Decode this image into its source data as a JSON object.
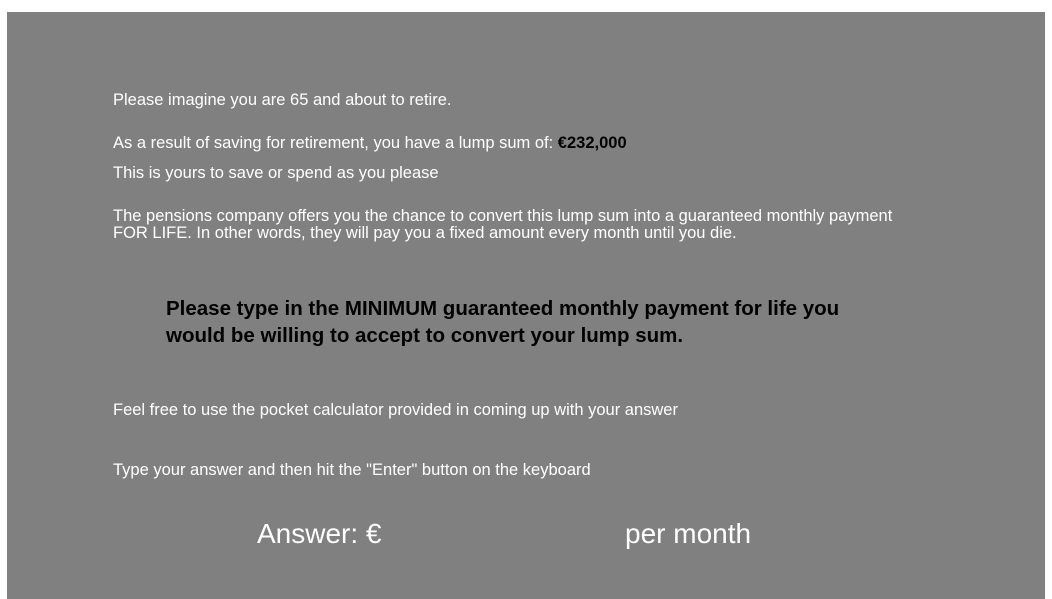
{
  "intro": "Please imagine you are 65 and about to retire.",
  "lump_sum_text": "As a result of saving for retirement, you have a lump sum of:",
  "lump_sum_amount": "€232,000",
  "yours_text": "This is yours to save or spend as you please",
  "offer_text": "The pensions company offers you the chance to convert this lump sum into a guaranteed monthly payment FOR LIFE. In other words, they will pay you a fixed amount every month until you die.",
  "instruction": "Please type in the MINIMUM guaranteed monthly payment for life you would be willing to accept to convert your lump sum.",
  "calculator_text": "Feel free to use the pocket calculator provided in coming up with your answer",
  "enter_text": "Type your answer and then hit the \"Enter\" button on the keyboard",
  "answer": {
    "label": "Answer: €",
    "value": "",
    "suffix": "per month"
  }
}
